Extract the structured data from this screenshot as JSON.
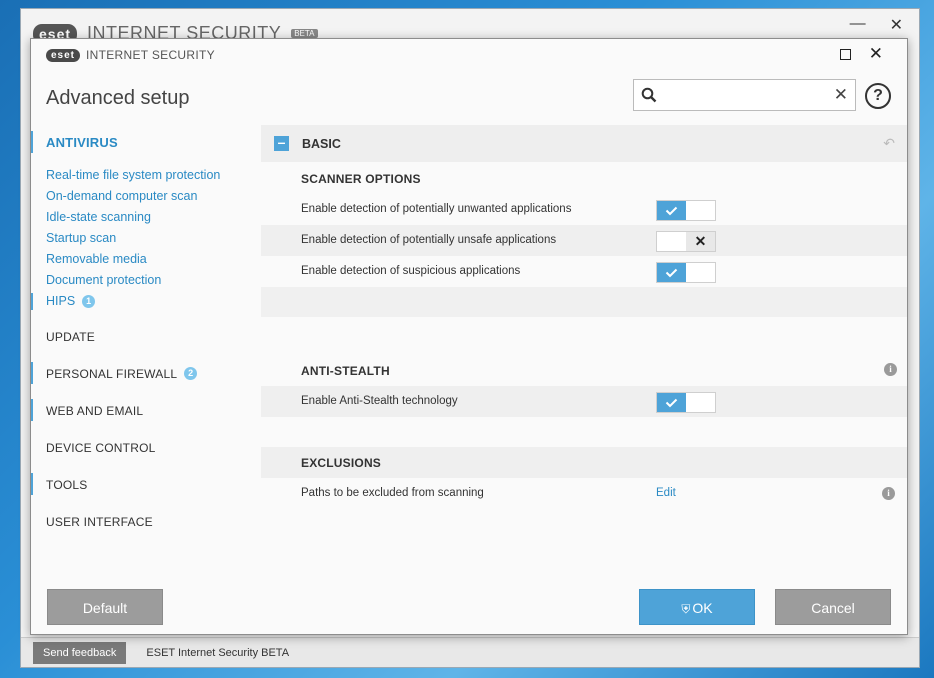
{
  "background_window": {
    "logo": "eset",
    "title": "INTERNET SECURITY",
    "beta": "BETA",
    "feedback_button": "Send feedback",
    "status_text": "ESET Internet Security BETA"
  },
  "dialog": {
    "logo": "eset",
    "app_name": "INTERNET SECURITY",
    "heading": "Advanced setup",
    "search": {
      "placeholder": "",
      "value": ""
    }
  },
  "sidebar": {
    "sections": [
      {
        "label": "ANTIVIRUS",
        "active": true
      },
      {
        "label": "UPDATE"
      },
      {
        "label": "PERSONAL FIREWALL",
        "badge": "2"
      },
      {
        "label": "WEB AND EMAIL"
      },
      {
        "label": "DEVICE CONTROL"
      },
      {
        "label": "TOOLS"
      },
      {
        "label": "USER INTERFACE"
      }
    ],
    "antivirus_items": [
      {
        "label": "Real-time file system protection"
      },
      {
        "label": "On-demand computer scan"
      },
      {
        "label": "Idle-state scanning"
      },
      {
        "label": "Startup scan"
      },
      {
        "label": "Removable media"
      },
      {
        "label": "Document protection"
      },
      {
        "label": "HIPS",
        "badge": "1"
      }
    ]
  },
  "content": {
    "section_title": "BASIC",
    "scanner_options": {
      "title": "SCANNER OPTIONS",
      "rows": [
        {
          "label": "Enable detection of potentially unwanted applications",
          "enabled": true
        },
        {
          "label": "Enable detection of potentially unsafe applications",
          "enabled": false
        },
        {
          "label": "Enable detection of suspicious applications",
          "enabled": true
        }
      ]
    },
    "anti_stealth": {
      "title": "ANTI-STEALTH",
      "rows": [
        {
          "label": "Enable Anti-Stealth technology",
          "enabled": true
        }
      ]
    },
    "exclusions": {
      "title": "EXCLUSIONS",
      "rows": [
        {
          "label": "Paths to be excluded from scanning",
          "action": "Edit"
        }
      ]
    }
  },
  "buttons": {
    "default": "Default",
    "ok": "OK",
    "cancel": "Cancel"
  },
  "colors": {
    "accent": "#4ea3d8",
    "link": "#2a8ac4",
    "button_gray": "#9c9c9c"
  }
}
